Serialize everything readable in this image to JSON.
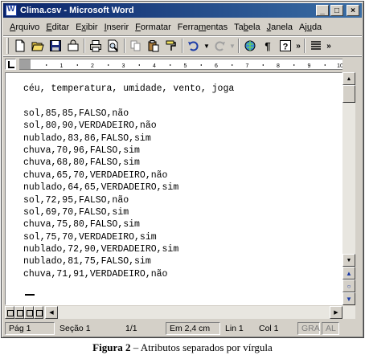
{
  "window": {
    "title": "Clima.csv - Microsoft Word",
    "minimize_glyph": "_",
    "maximize_glyph": "□",
    "close_glyph": "×"
  },
  "menu": {
    "items": [
      {
        "underline": "A",
        "rest": "rquivo"
      },
      {
        "underline": "E",
        "rest": "ditar"
      },
      {
        "underline": "x",
        "pre": "E",
        "rest": "ibir"
      },
      {
        "underline": "I",
        "rest": "nserir"
      },
      {
        "underline": "F",
        "rest": "ormatar"
      },
      {
        "underline": "m",
        "pre": "Ferra",
        "rest": "entas"
      },
      {
        "underline": "b",
        "pre": "Ta",
        "rest": "ela"
      },
      {
        "underline": "J",
        "rest": "anela"
      },
      {
        "underline": "u",
        "pre": "Aj",
        "rest": "da"
      }
    ]
  },
  "toolbar": {
    "icons": [
      "new-document-icon",
      "open-folder-icon",
      "save-icon",
      "permission-icon",
      "print-icon",
      "print-preview-icon",
      "copy-icon",
      "paste-icon",
      "format-painter-icon",
      "undo-icon",
      "redo-icon",
      "hyperlink-icon",
      "show-formatting-icon",
      "help-icon",
      "more-buttons-icon",
      "justify-icon"
    ]
  },
  "ruler": {
    "numbers": [
      "1",
      "2",
      "3",
      "4",
      "5",
      "6",
      "7",
      "8",
      "9",
      "10"
    ]
  },
  "document": {
    "lines": [
      "céu, temperatura, umidade, vento, joga",
      "",
      "sol,85,85,FALSO,não",
      "sol,80,90,VERDADEIRO,não",
      "nublado,83,86,FALSO,sim",
      "chuva,70,96,FALSO,sim",
      "chuva,68,80,FALSO,sim",
      "chuva,65,70,VERDADEIRO,não",
      "nublado,64,65,VERDADEIRO,sim",
      "sol,72,95,FALSO,não",
      "sol,69,70,FALSO,sim",
      "chuva,75,80,FALSO,sim",
      "sol,75,70,VERDADEIRO,sim",
      "nublado,72,90,VERDADEIRO,sim",
      "nublado,81,75,FALSO,sim",
      "chuva,71,91,VERDADEIRO,não"
    ]
  },
  "status": {
    "page": "Pág 1",
    "section": "Seção 1",
    "page_of": "1/1",
    "position": "Em 2,4 cm",
    "line": "Lin 1",
    "column": "Col 1",
    "rec": "GRA",
    "ovr": "AL"
  },
  "caption": {
    "label": "Figura 2",
    "text": " – Atributos separados por vírgula"
  },
  "colors": {
    "title_bar_start": "#0a246a",
    "title_bar_end": "#3a6ea5",
    "chrome": "#d4d0c8"
  }
}
